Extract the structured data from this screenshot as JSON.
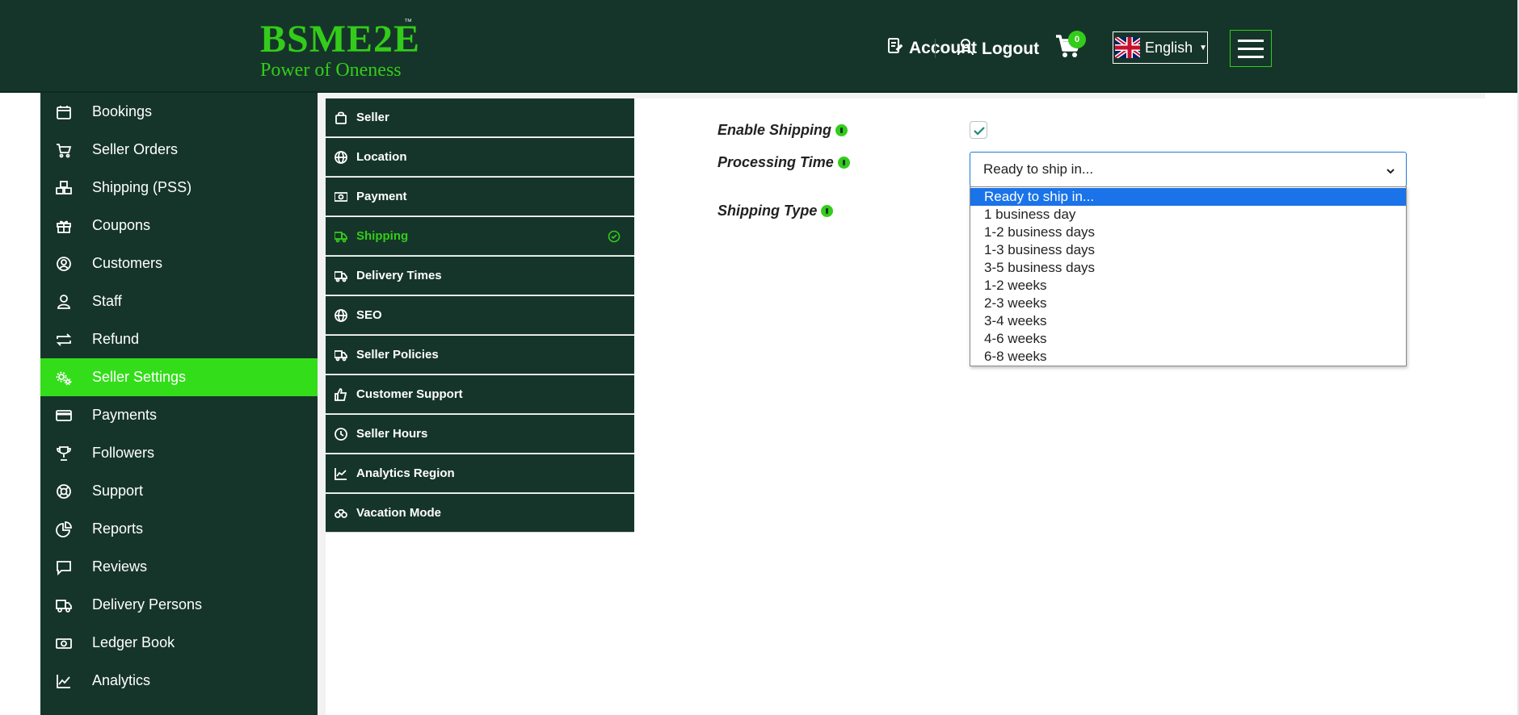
{
  "brand": {
    "name": "BSME2E",
    "trademark": "™",
    "tagline": "Power of Oneness",
    "color_primary": "#16352a",
    "color_accent": "#33cc1a"
  },
  "header": {
    "account_label": "Account",
    "account_icon": "document-edit-icon",
    "logout_label": "Logout",
    "logout_icon": "user-icon",
    "cart_icon": "shopping-cart-icon",
    "cart_count": "0",
    "language_label": "English",
    "language_flag": "uk-flag-icon",
    "menu_icon": "hamburger-menu-icon"
  },
  "sidebar": {
    "items": [
      {
        "label": "Bookings",
        "icon": "calendar-icon"
      },
      {
        "label": "Seller Orders",
        "icon": "cart-icon"
      },
      {
        "label": "Shipping (PSS)",
        "icon": "boxes-icon"
      },
      {
        "label": "Coupons",
        "icon": "gift-icon"
      },
      {
        "label": "Customers",
        "icon": "user-circle-icon"
      },
      {
        "label": "Staff",
        "icon": "person-icon"
      },
      {
        "label": "Refund",
        "icon": "refund-arrows-icon"
      },
      {
        "label": "Seller Settings",
        "icon": "gears-icon",
        "active": true
      },
      {
        "label": "Payments",
        "icon": "credit-card-icon"
      },
      {
        "label": "Followers",
        "icon": "trophy-icon"
      },
      {
        "label": "Support",
        "icon": "lifebuoy-icon"
      },
      {
        "label": "Reports",
        "icon": "pie-chart-icon"
      },
      {
        "label": "Reviews",
        "icon": "message-icon"
      },
      {
        "label": "Delivery Persons",
        "icon": "truck-icon"
      },
      {
        "label": "Ledger Book",
        "icon": "money-icon"
      },
      {
        "label": "Analytics",
        "icon": "line-chart-icon"
      }
    ]
  },
  "settings_tabs": [
    {
      "label": "Seller",
      "icon": "bag-icon"
    },
    {
      "label": "Location",
      "icon": "globe-icon"
    },
    {
      "label": "Payment",
      "icon": "money-icon"
    },
    {
      "label": "Shipping",
      "icon": "truck-icon",
      "active": true
    },
    {
      "label": "Delivery Times",
      "icon": "truck-clock-icon"
    },
    {
      "label": "SEO",
      "icon": "globe-icon"
    },
    {
      "label": "Seller Policies",
      "icon": "truck-policy-icon"
    },
    {
      "label": "Customer Support",
      "icon": "thumbs-up-icon"
    },
    {
      "label": "Seller Hours",
      "icon": "clock-icon"
    },
    {
      "label": "Analytics Region",
      "icon": "line-chart-icon"
    },
    {
      "label": "Vacation Mode",
      "icon": "binoculars-icon"
    }
  ],
  "form": {
    "enable_shipping_label": "Enable Shipping",
    "enable_shipping_checked": true,
    "processing_time_label": "Processing Time",
    "processing_time_value": "Ready to ship in...",
    "shipping_type_label": "Shipping Type",
    "processing_time_options": [
      "Ready to ship in...",
      "1 business day",
      "1-2 business days",
      "1-3 business days",
      "3-5 business days",
      "1-2 weeks",
      "2-3 weeks",
      "3-4 weeks",
      "4-6 weeks",
      "6-8 weeks"
    ],
    "selected_option_index": 0
  }
}
